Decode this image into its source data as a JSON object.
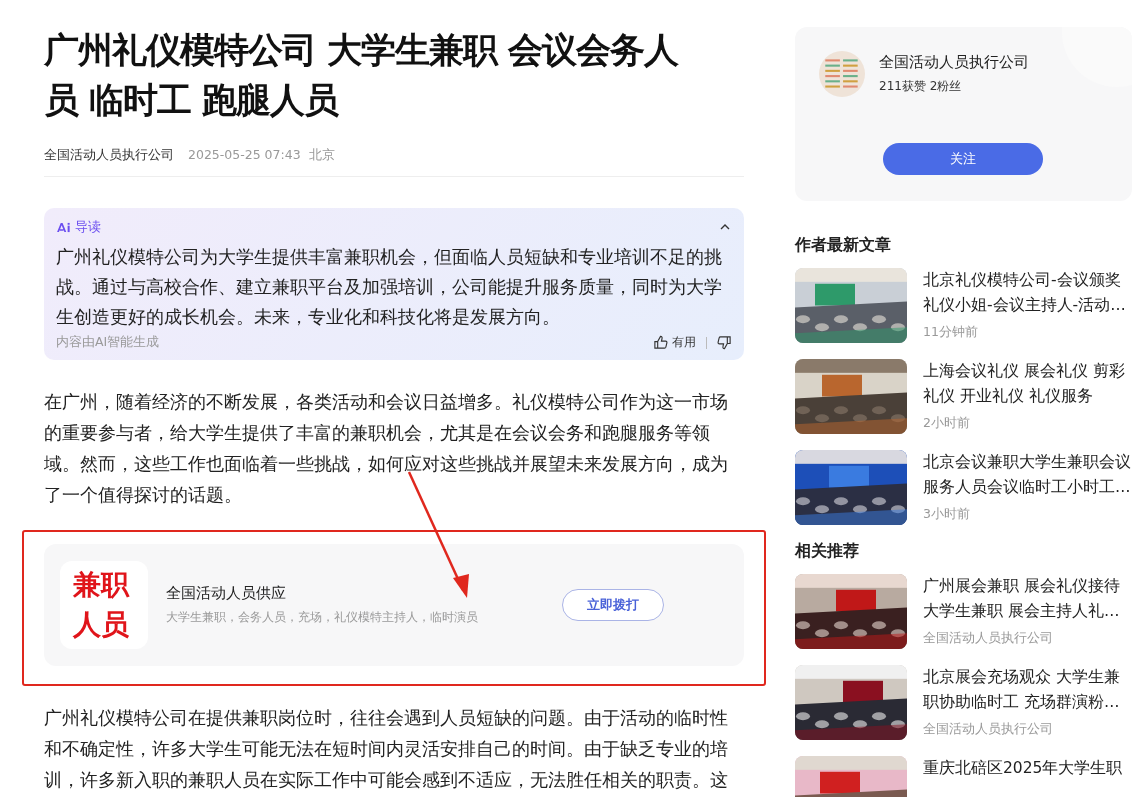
{
  "article": {
    "title": "广州礼仪模特公司 大学生兼职 会议会务人员 临时工 跑腿人员",
    "author": "全国活动人员执行公司",
    "date": "2025-05-25 07:43",
    "location": "北京",
    "ai_summary": {
      "label": "导读",
      "expanded": true,
      "text": "广州礼仪模特公司为大学生提供丰富兼职机会，但面临人员短缺和专业培训不足的挑战。通过与高校合作、建立兼职平台及加强培训，公司能提升服务质量，同时为大学生创造更好的成长机会。未来，专业化和科技化将是发展方向。",
      "source": "内容由AI智能生成",
      "useful_label": "有用"
    },
    "paragraphs": [
      "在广州，随着经济的不断发展，各类活动和会议日益增多。礼仪模特公司作为这一市场的重要参与者，给大学生提供了丰富的兼职机会，尤其是在会议会务和跑腿服务等领域。然而，这些工作也面临着一些挑战，如何应对这些挑战并展望未来发展方向，成为了一个值得探讨的话题。",
      "广州礼仪模特公司在提供兼职岗位时，往往会遇到人员短缺的问题。由于活动的临时性和不确定性，许多大学生可能无法在短时间内灵活安排自己的时间。由于缺乏专业的培训，许多新入职的兼职人员在实际工作中可能会感到不适应，无法胜任相关的职责。这"
    ],
    "contact_card": {
      "logo_text": "兼职人员",
      "name": "全国活动人员供应",
      "tags": "大学生兼职，会务人员，充场，礼仪模特主持人，临时演员",
      "button": "立即拨打"
    }
  },
  "author_card": {
    "name": "全国活动人员执行公司",
    "stats": "211获赞 2粉丝",
    "follow_button": "关注"
  },
  "latest_articles": {
    "heading": "作者最新文章",
    "items": [
      {
        "title": "北京礼仪模特公司-会议颁奖礼仪小姐-会议主持人-活动…",
        "meta": "11分钟前"
      },
      {
        "title": "上海会议礼仪 展会礼仪 剪彩礼仪 开业礼仪 礼仪服务",
        "meta": "2小时前"
      },
      {
        "title": "北京会议兼职大学生兼职会议服务人员会议临时工小时工…",
        "meta": "3小时前"
      }
    ]
  },
  "recommended": {
    "heading": "相关推荐",
    "items": [
      {
        "title": "广州展会兼职 展会礼仪接待大学生兼职 展会主持人礼…",
        "meta": "全国活动人员执行公司"
      },
      {
        "title": "北京展会充场观众 大学生兼职协助临时工 充场群演粉…",
        "meta": "全国活动人员执行公司"
      },
      {
        "title": "重庆北碚区2025年大学生职"
      }
    ]
  }
}
